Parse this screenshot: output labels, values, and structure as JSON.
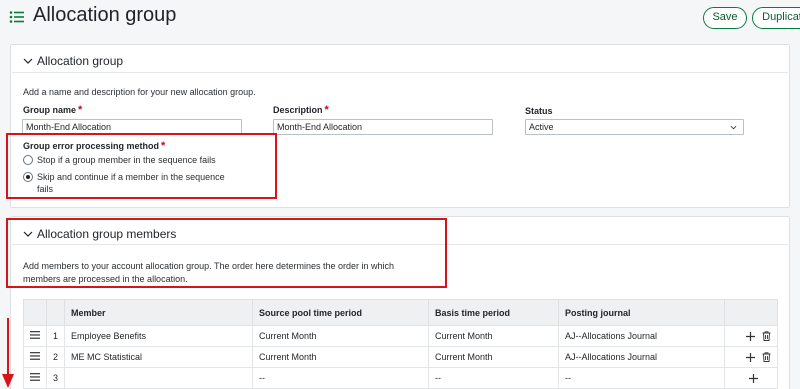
{
  "header": {
    "title": "Allocation group",
    "save_label": "Save",
    "duplicate_label": "Duplicat"
  },
  "section1": {
    "title": "Allocation group",
    "description": "Add a name and description for your new allocation group.",
    "group_name": {
      "label": "Group name",
      "value": "Month-End Allocation"
    },
    "description_field": {
      "label": "Description",
      "value": "Month-End Allocation"
    },
    "status": {
      "label": "Status",
      "value": "Active"
    },
    "error_method": {
      "label": "Group error processing method",
      "options": [
        {
          "label": "Stop if a group member in the sequence fails",
          "checked": false
        },
        {
          "label_line1": "Skip and continue if a member in the sequence",
          "label_line2": "fails",
          "checked": true
        }
      ]
    }
  },
  "section2": {
    "title": "Allocation group members",
    "description_line1": "Add members to your account allocation group. The order here determines the order in which",
    "description_line2": "members are processed in the allocation.",
    "columns": [
      "Member",
      "Source pool time period",
      "Basis time period",
      "Posting journal"
    ],
    "rows": [
      {
        "num": "1",
        "member": "Employee Benefits",
        "source": "Current Month",
        "basis": "Current Month",
        "journal": "AJ--Allocations Journal"
      },
      {
        "num": "2",
        "member": "ME MC Statistical",
        "source": "Current Month",
        "basis": "Current Month",
        "journal": "AJ--Allocations Journal"
      },
      {
        "num": "3",
        "member": "",
        "source": "--",
        "basis": "--",
        "journal": "--"
      }
    ]
  },
  "colors": {
    "accent": "#0a7b3e",
    "highlight": "#d7141a",
    "required": "#d0021b"
  }
}
